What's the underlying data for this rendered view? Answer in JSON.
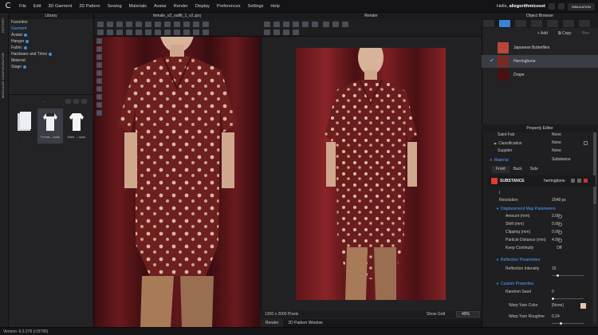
{
  "app": {
    "logo_glyph": "C"
  },
  "menu": [
    "File",
    "Edit",
    "3D Garment",
    "2D Pattern",
    "Sewing",
    "Materials",
    "Avatar",
    "Render",
    "Display",
    "Preferences",
    "Settings",
    "Help"
  ],
  "user": {
    "greeting": "Hello,",
    "name": "allegorithmiceset",
    "sim_label": "SIMULATION"
  },
  "side_tabs": [
    "HISTORY",
    "MODULAR CONFIGURATOR"
  ],
  "library": {
    "title": "Library",
    "tree": [
      {
        "label": "Favorites",
        "selected": false,
        "dot": false
      },
      {
        "label": "Garment",
        "selected": true,
        "dot": false
      },
      {
        "label": "Avatar",
        "selected": false,
        "dot": true
      },
      {
        "label": "Hanger",
        "selected": false,
        "dot": true
      },
      {
        "label": "Fabric",
        "selected": false,
        "dot": true
      },
      {
        "label": "Hardware and Trims",
        "selected": false,
        "dot": true
      },
      {
        "label": "Material",
        "selected": false,
        "dot": false
      },
      {
        "label": "Stage",
        "selected": false,
        "dot": true
      }
    ],
    "thumbs": [
      {
        "caption": ".."
      },
      {
        "caption": "Femal....zpac"
      },
      {
        "caption": "Male ....zpac"
      }
    ]
  },
  "viewport3d": {
    "title": "female_v2_outfit_1_v2.zprj"
  },
  "render": {
    "title": "Render",
    "pixels": "1200 x 2000 Pixels",
    "show_grid": "Show Grid",
    "zoom": "40%",
    "tabs": [
      "Render",
      "2D Pattern Window"
    ]
  },
  "object_browser": {
    "title": "Object Browser",
    "add": "Add",
    "copy": "Copy",
    "fabrics": [
      {
        "name": "Japanese Butterflies",
        "color": "#b8463a",
        "selected": false
      },
      {
        "name": "Herringbone",
        "color": "#7a2a25",
        "selected": true
      },
      {
        "name": "Drape",
        "color": "#4a1012",
        "selected": false
      }
    ]
  },
  "property_editor": {
    "title": "Property Editor",
    "rows_top": [
      {
        "k": "Saint Fab",
        "v": "None"
      },
      {
        "k": "Classification",
        "v": "None"
      },
      {
        "k": "Supplier",
        "v": "None"
      }
    ],
    "material_label": "Material",
    "material_value": "Substance",
    "material_tabs": [
      "Front",
      "Back",
      "Side"
    ],
    "substance_brand": "SUBSTANCE",
    "substance_file": "herringbone",
    "resolution_label": "Resolution",
    "resolution_value": "2048 px",
    "displacement_title": "Displacement Map Parameters",
    "displacement": [
      {
        "k": "Amount (mm)",
        "v": "3.00"
      },
      {
        "k": "Shift (mm)",
        "v": "0.00"
      },
      {
        "k": "Clipping (mm)",
        "v": "0.00"
      },
      {
        "k": "Particle Distance (mm)",
        "v": "4.00"
      },
      {
        "k": "Keep Continuity",
        "v": "Off"
      }
    ],
    "reflection_title": "Reflection Parameters",
    "reflection": [
      {
        "k": "Reflection Intensity",
        "v": "15"
      }
    ],
    "custom_title": "Custom Properties",
    "custom": [
      {
        "k": "Random Seed",
        "v": "0"
      },
      {
        "k": "Warp Yarn Color",
        "v": "[None]"
      },
      {
        "k": "Warp Yarn Roughne",
        "v": "0.24"
      }
    ]
  },
  "status": {
    "version": "Version: 6.0.278 (r33785)"
  },
  "colors": {
    "accent": "#4da3ff",
    "garment": "#6e1f1f",
    "curtain": "#5a1418"
  }
}
